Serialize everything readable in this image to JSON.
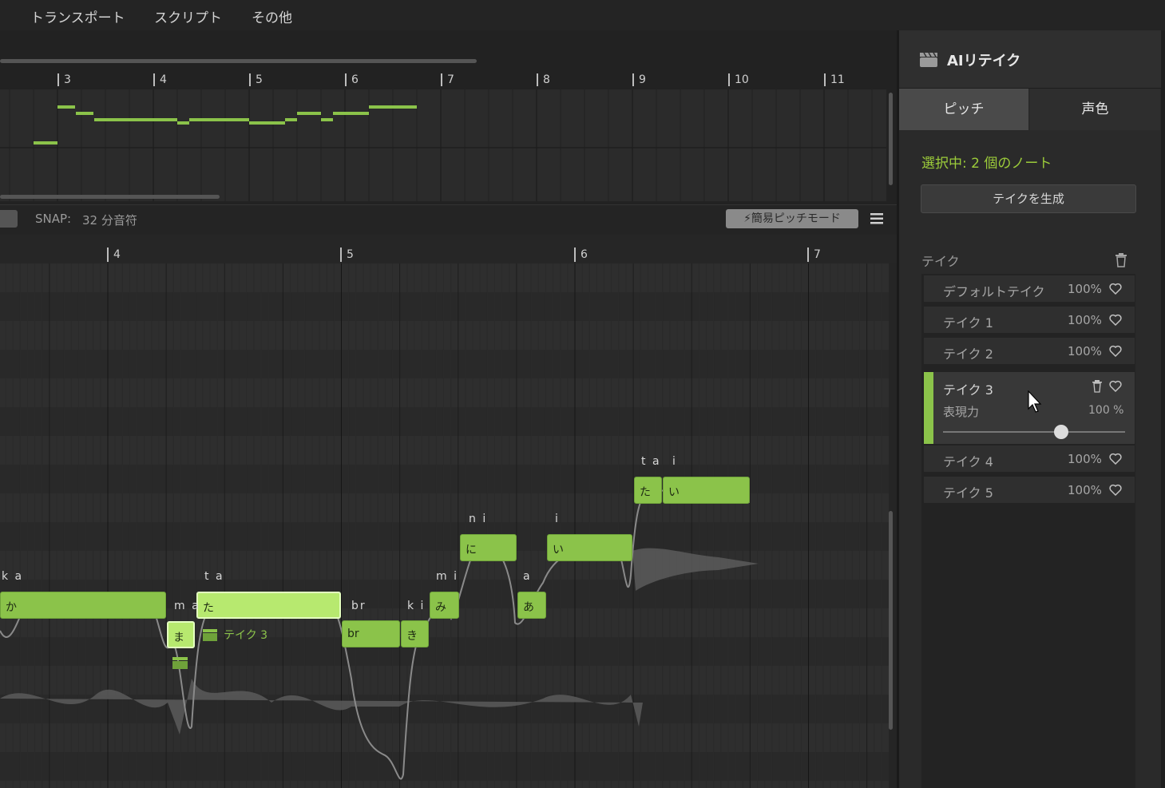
{
  "menu": {
    "items": [
      "トランスポート",
      "スクリプト",
      "その他"
    ]
  },
  "overview": {
    "bars": [
      "3",
      "4",
      "5",
      "6",
      "7",
      "8",
      "9",
      "10",
      "11"
    ]
  },
  "toolbar": {
    "snap_label": "SNAP:",
    "snap_value": "32 分音符",
    "pitch_mode_label": "簡易ピッチモード"
  },
  "main_ruler": {
    "bars": [
      "4",
      "5",
      "6",
      "7"
    ]
  },
  "notes": [
    {
      "lyric": "か",
      "phoneme": "k a"
    },
    {
      "lyric": "ま",
      "phoneme": "m a"
    },
    {
      "lyric": "た",
      "phoneme": "t a"
    },
    {
      "lyric": "br",
      "phoneme": "br"
    },
    {
      "lyric": "き",
      "phoneme": "k i"
    },
    {
      "lyric": "み",
      "phoneme": "m i"
    },
    {
      "lyric": "に",
      "phoneme": "n i"
    },
    {
      "lyric": "あ",
      "phoneme": "a"
    },
    {
      "lyric": "い",
      "phoneme": "i"
    },
    {
      "lyric": "た",
      "phoneme": "t a"
    },
    {
      "lyric": "い",
      "phoneme": "i"
    }
  ],
  "take_tag": "テイク 3",
  "panel": {
    "title": "AIリテイク",
    "tabs": {
      "pitch": "ピッチ",
      "voice": "声色"
    },
    "selection_text": "選択中: 2 個のノート",
    "generate_button": "テイクを生成",
    "takes_label": "テイク",
    "takes": [
      {
        "name": "デフォルトテイク",
        "pct": "100%"
      },
      {
        "name": "テイク 1",
        "pct": "100%"
      },
      {
        "name": "テイク 2",
        "pct": "100%"
      },
      {
        "name": "テイク 3",
        "pct": "100%"
      },
      {
        "name": "テイク 4",
        "pct": "100%"
      },
      {
        "name": "テイク 5",
        "pct": "100%"
      }
    ],
    "selected_take": {
      "name": "テイク 3",
      "expression_label": "表現力",
      "expression_value": "100 %",
      "expression_level": 0.65
    }
  },
  "colors": {
    "accent": "#8bc34a",
    "note_selected": "#b7e96f",
    "bg": "#252525"
  }
}
